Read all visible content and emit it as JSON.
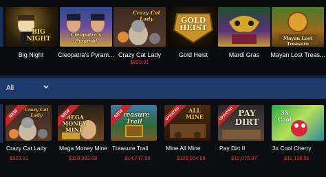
{
  "featured_games": [
    {
      "name": "Big Night",
      "jackpot": "",
      "art_title": "BIG NIGHT"
    },
    {
      "name": "Cleopatra's Pyram...",
      "jackpot": "",
      "art_title": "Cleopatra's Pyramid"
    },
    {
      "name": "Crazy Cat Lady",
      "jackpot": "$323.91",
      "art_title": "Crazy Cat Lady"
    },
    {
      "name": "Gold Heist",
      "jackpot": "",
      "art_title": "GOLD HEIST"
    },
    {
      "name": "Mardi Gras",
      "jackpot": "",
      "art_title": ""
    },
    {
      "name": "Mayan Lost Treas...",
      "jackpot": "",
      "art_title": "Mayan Lost Treasure"
    }
  ],
  "filter": {
    "selected": "All"
  },
  "grid_games": [
    {
      "name": "Crazy Cat Lady",
      "jackpot": "$323.91",
      "ribbon": "NEW",
      "art_title": "Crazy Cat Lady"
    },
    {
      "name": "Mega Money Mine",
      "jackpot": "$118,983.68",
      "ribbon": "NEW",
      "art_title": "MEGA MONEY MINE"
    },
    {
      "name": "Treasure Trail",
      "jackpot": "$14,747.90",
      "ribbon": "NEW",
      "art_title": "Treasure Trail"
    },
    {
      "name": "Mine All Mine",
      "jackpot": "$120,554.98",
      "ribbon": "UPDATED",
      "art_title": "ALL MINE"
    },
    {
      "name": "Pay Dirt II",
      "jackpot": "$12,075.37",
      "ribbon": "UPDATED",
      "art_title": "PAY DIRT"
    },
    {
      "name": "3x Cool Cherry",
      "jackpot": "$11,136.51",
      "ribbon": "",
      "art_title": "3X Cool"
    }
  ],
  "colors": {
    "accent_bar": "#1f3b6c",
    "jackpot_text": "#d84a3a",
    "ribbon": "#c1272d"
  }
}
